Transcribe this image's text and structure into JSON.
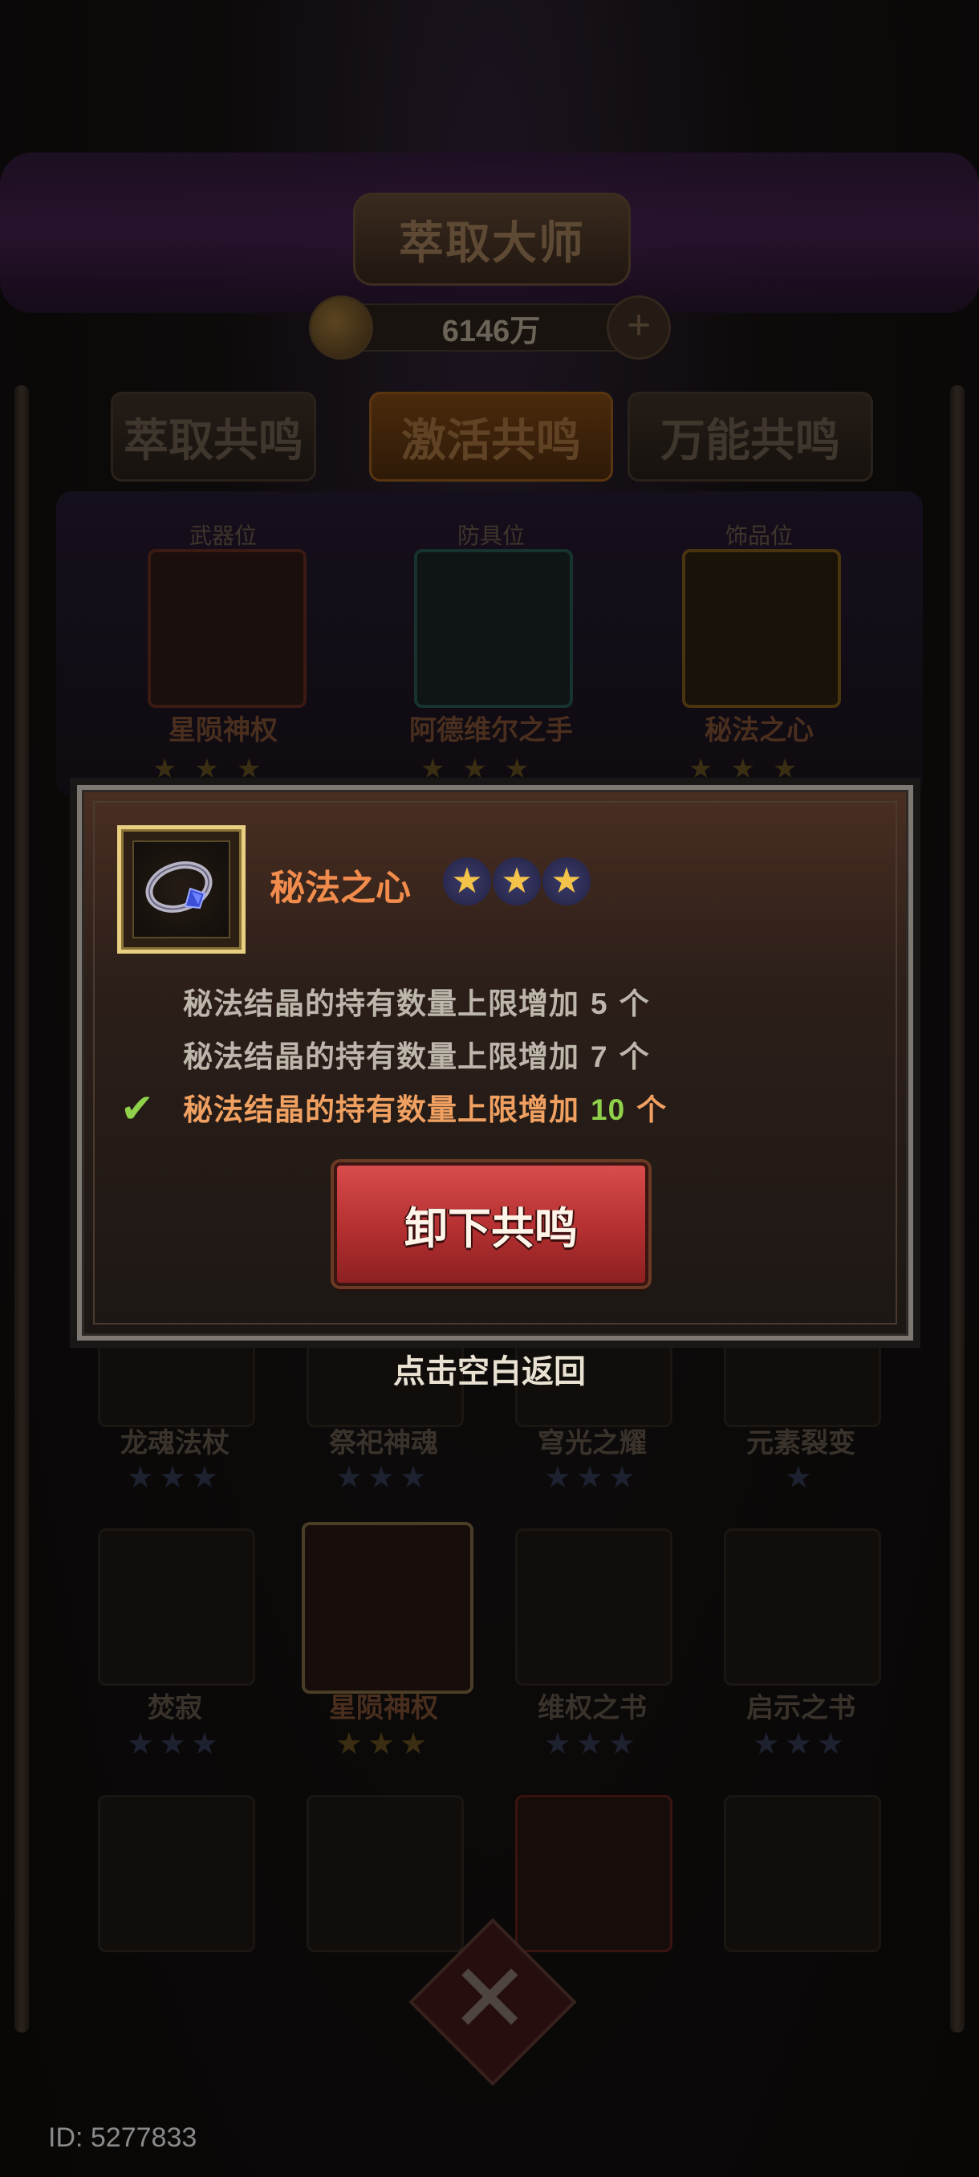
{
  "header": {
    "title": "萃取大师",
    "currency": "6146万",
    "tabs": [
      {
        "label": "萃取共鸣",
        "active": false
      },
      {
        "label": "激活共鸣",
        "active": true
      },
      {
        "label": "万能共鸣",
        "active": false
      }
    ]
  },
  "slots": [
    {
      "label": "武器位",
      "name": "星陨神权",
      "stars": 3
    },
    {
      "label": "防具位",
      "name": "阿德维尔之手",
      "stars": 3
    },
    {
      "label": "饰品位",
      "name": "秘法之心",
      "stars": 3
    }
  ],
  "grid": {
    "row1": [
      {
        "name": "龙魂法杖",
        "stars": 3
      },
      {
        "name": "祭祀神魂",
        "stars": 3
      },
      {
        "name": "穹光之耀",
        "stars": 3
      },
      {
        "name": "元素裂变",
        "stars": 1
      }
    ],
    "row2": [
      {
        "name": "焚寂",
        "stars": 3
      },
      {
        "name": "星陨神权",
        "stars": 3
      },
      {
        "name": "维权之书",
        "stars": 3
      },
      {
        "name": "启示之书",
        "stars": 3
      }
    ]
  },
  "popup": {
    "item_name": "秘法之心",
    "stars": 3,
    "effects": [
      {
        "text": "秘法结晶的持有数量上限增加",
        "value": "5",
        "unit": "个",
        "active": false
      },
      {
        "text": "秘法结晶的持有数量上限增加",
        "value": "7",
        "unit": "个",
        "active": false
      },
      {
        "text": "秘法结晶的持有数量上限增加",
        "value": "10",
        "unit": "个",
        "active": true
      }
    ],
    "button_label": "卸下共鸣"
  },
  "hint": "点击空白返回",
  "footer": {
    "id_text": "ID: 5277833"
  },
  "colors": {
    "accent_orange": "#f28c4c",
    "active_green": "#8fd14a",
    "button_red": "#b32f30",
    "frame_gold": "#e8cf82"
  }
}
